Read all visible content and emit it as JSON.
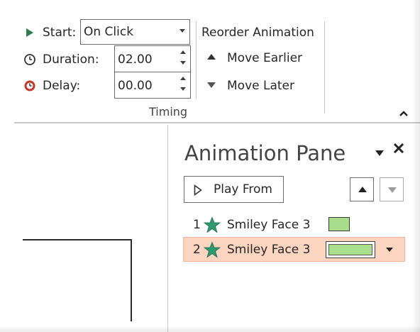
{
  "timing": {
    "start_label": "Start:",
    "start_value": "On Click",
    "duration_label": "Duration:",
    "duration_value": "02.00",
    "delay_label": "Delay:",
    "delay_value": "00.00",
    "group_label": "Timing"
  },
  "reorder": {
    "title": "Reorder Animation",
    "move_earlier": "Move Earlier",
    "move_later": "Move Later"
  },
  "pane": {
    "title": "Animation Pane",
    "play_from": "Play From",
    "items": [
      {
        "index": "1",
        "name": "Smiley Face 3",
        "selected": false
      },
      {
        "index": "2",
        "name": "Smiley Face 3",
        "selected": true
      }
    ]
  },
  "colors": {
    "star": "#2f9a6f",
    "bar": "#a9de8c",
    "selection": "#fcd5c1",
    "delay_icon": "#c0392b"
  }
}
